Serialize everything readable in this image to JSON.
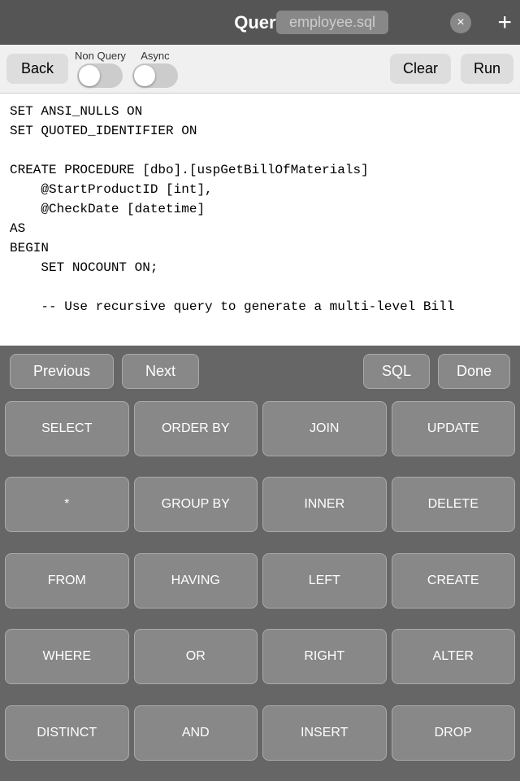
{
  "header": {
    "title": "Query",
    "tab_label": "employee.sql",
    "add_label": "+",
    "close_label": "×"
  },
  "toolbar": {
    "back_label": "Back",
    "non_query_label": "Non Query",
    "async_label": "Async",
    "clear_label": "Clear",
    "run_label": "Run"
  },
  "code": {
    "content": "SET ANSI_NULLS ON\nSET QUOTED_IDENTIFIER ON\n\nCREATE PROCEDURE [dbo].[uspGetBillOfMaterials]\n    @StartProductID [int],\n    @CheckDate [datetime]\nAS\nBEGIN\n    SET NOCOUNT ON;\n\n    -- Use recursive query to generate a multi-level Bill"
  },
  "nav": {
    "prev_label": "Previous",
    "next_label": "Next",
    "sql_label": "SQL",
    "done_label": "Done"
  },
  "keywords": [
    "SELECT",
    "ORDER BY",
    "JOIN",
    "UPDATE",
    "*",
    "GROUP BY",
    "INNER",
    "DELETE",
    "FROM",
    "HAVING",
    "LEFT",
    "CREATE",
    "WHERE",
    "OR",
    "RIGHT",
    "ALTER",
    "DISTINCT",
    "AND",
    "INSERT",
    "DROP"
  ]
}
